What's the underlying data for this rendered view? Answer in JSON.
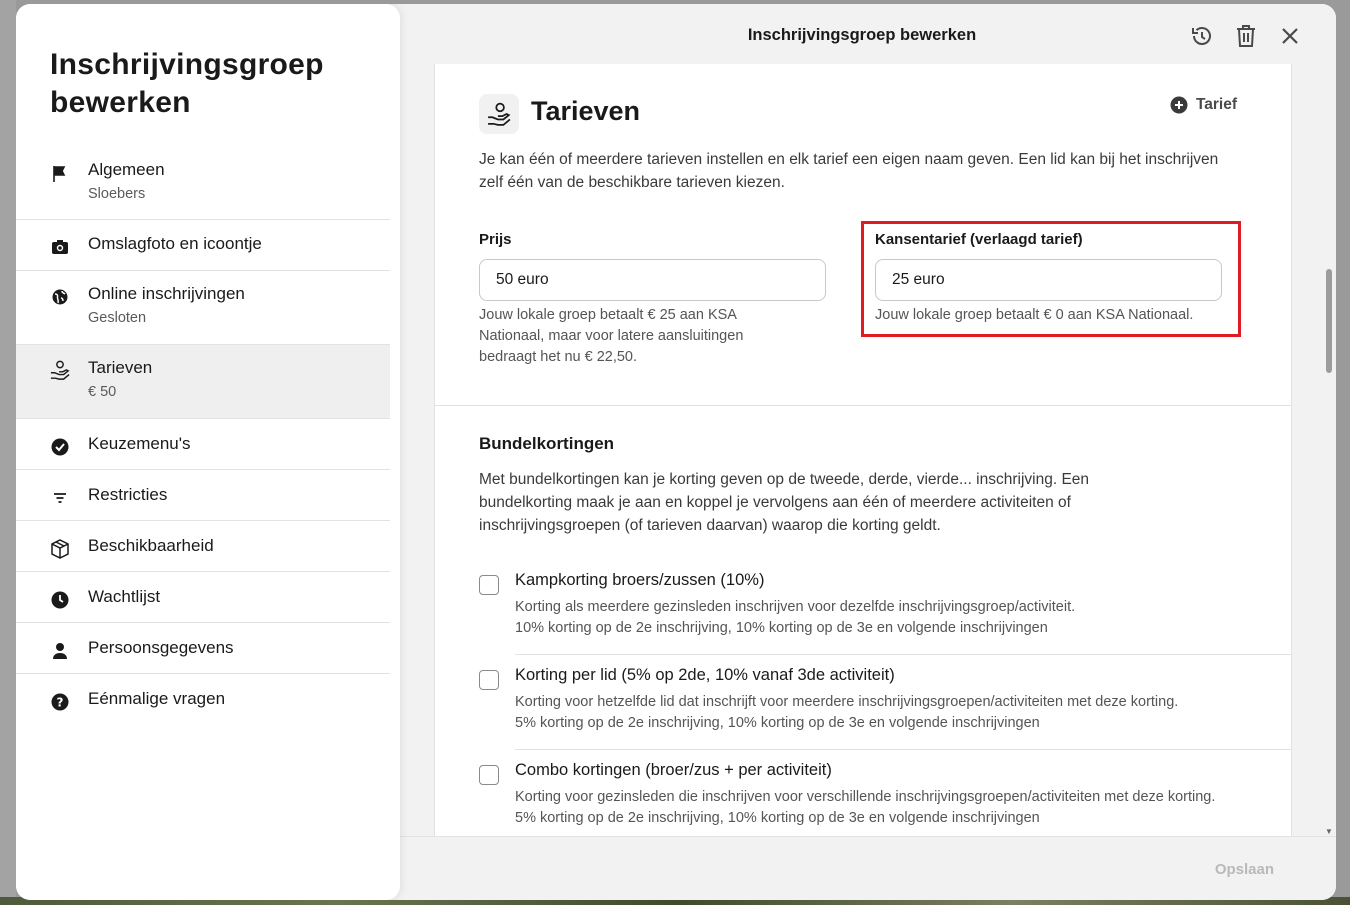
{
  "sidebar": {
    "title": "Inschrijvingsgroep bewerken",
    "items": [
      {
        "label": "Algemeen",
        "sub": "Sloebers",
        "icon": "flag-icon"
      },
      {
        "label": "Omslagfoto en icoontje",
        "sub": "",
        "icon": "camera-icon"
      },
      {
        "label": "Online inschrijvingen",
        "sub": "Gesloten",
        "icon": "globe-icon"
      },
      {
        "label": "Tarieven",
        "sub": "€ 50",
        "icon": "hand-coins-icon"
      },
      {
        "label": "Keuzemenu's",
        "sub": "",
        "icon": "check-circle-icon"
      },
      {
        "label": "Restricties",
        "sub": "",
        "icon": "filter-icon"
      },
      {
        "label": "Beschikbaarheid",
        "sub": "",
        "icon": "box-icon"
      },
      {
        "label": "Wachtlijst",
        "sub": "",
        "icon": "clock-icon"
      },
      {
        "label": "Persoonsgegevens",
        "sub": "",
        "icon": "user-icon"
      },
      {
        "label": "Eénmalige vragen",
        "sub": "",
        "icon": "question-icon"
      }
    ]
  },
  "header": {
    "title": "Inschrijvingsgroep bewerken"
  },
  "section": {
    "title": "Tarieven",
    "add_label": "Tarief",
    "description": "Je kan één of meerdere tarieven instellen en elk tarief een eigen naam geven. Een lid kan bij het inschrijven zelf één van de beschikbare tarieven kiezen.",
    "price": {
      "label": "Prijs",
      "value": "50 euro",
      "help": "Jouw lokale groep betaalt € 25 aan KSA Nationaal, maar voor latere aansluitingen bedraagt het nu € 22,50."
    },
    "reduced": {
      "label": "Kansentarief (verlaagd tarief)",
      "value": "25 euro",
      "help": "Jouw lokale groep betaalt € 0 aan KSA Nationaal."
    }
  },
  "bundles": {
    "title": "Bundelkortingen",
    "description": "Met bundelkortingen kan je korting geven op de tweede, derde, vierde... inschrijving. Een bundelkorting maak je aan en koppel je vervolgens aan één of meerdere activiteiten of inschrijvingsgroepen (of tarieven daarvan) waarop die korting geldt.",
    "items": [
      {
        "title": "Kampkorting broers/zussen (10%)",
        "line1": "Korting als meerdere gezinsleden inschrijven voor dezelfde inschrijvingsgroep/activiteit.",
        "line2": "10% korting op de 2e inschrijving, 10% korting op de 3e en volgende inschrijvingen"
      },
      {
        "title": "Korting per lid (5% op 2de, 10% vanaf 3de activiteit)",
        "line1": "Korting voor hetzelfde lid dat inschrijft voor meerdere inschrijvingsgroepen/activiteiten met deze korting.",
        "line2": "5% korting op de 2e inschrijving, 10% korting op de 3e en volgende inschrijvingen"
      },
      {
        "title": "Combo kortingen (broer/zus + per activiteit)",
        "line1": "Korting voor gezinsleden die inschrijven voor verschillende inschrijvingsgroepen/activiteiten met deze korting.",
        "line2": "5% korting op de 2e inschrijving, 10% korting op de 3e en volgende inschrijvingen"
      }
    ]
  },
  "footer": {
    "save_label": "Opslaan"
  },
  "colors": {
    "highlight": "#e01b24",
    "disabled_text": "#b9b9b9"
  }
}
